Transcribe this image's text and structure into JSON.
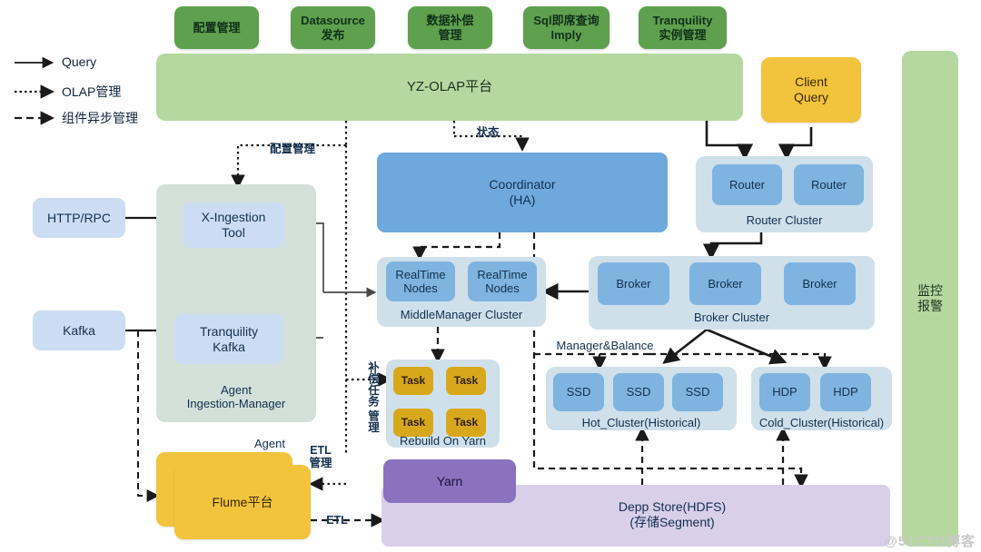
{
  "legend": {
    "items": [
      {
        "label": "Query",
        "style": "solid"
      },
      {
        "label": "OLAP管理",
        "style": "dotted"
      },
      {
        "label": "组件异步管理",
        "style": "dashed"
      }
    ]
  },
  "top_modules": [
    {
      "label": "配置管理"
    },
    {
      "label": "Datasource\n发布"
    },
    {
      "label": "数据补偿\n管理"
    },
    {
      "label": "Sql即席查询\nImply"
    },
    {
      "label": "Tranquility\n实例管理"
    }
  ],
  "platform": {
    "label": "YZ-OLAP平台"
  },
  "client": {
    "label": "Client\nQuery"
  },
  "monitor": {
    "label": "监控\n报警"
  },
  "sources": [
    {
      "label": "HTTP/RPC"
    },
    {
      "label": "Kafka"
    }
  ],
  "agent_group": {
    "caption": "Agent\nIngestion-Manager",
    "nodes": [
      {
        "label": "X-Ingestion\nTool"
      },
      {
        "label": "Tranquility\nKafka"
      }
    ]
  },
  "flume": {
    "label": "Flume平台",
    "badge": "Agent"
  },
  "coordinator": {
    "label": "Coordinator\n(HA)"
  },
  "middlemanager": {
    "caption": "MiddleManager Cluster",
    "nodes": [
      {
        "label": "RealTime\nNodes"
      },
      {
        "label": "RealTime\nNodes"
      }
    ]
  },
  "rebuild": {
    "caption": "Rebuild On Yarn",
    "tasks": [
      {
        "label": "Task"
      },
      {
        "label": "Task"
      },
      {
        "label": "Task"
      },
      {
        "label": "Task"
      }
    ]
  },
  "yarn": {
    "label": "Yarn"
  },
  "deep_store": {
    "label": "Depp Store(HDFS)\n(存储Segment)"
  },
  "router_cluster": {
    "caption": "Router Cluster",
    "nodes": [
      {
        "label": "Router"
      },
      {
        "label": "Router"
      }
    ]
  },
  "broker_cluster": {
    "caption": "Broker Cluster",
    "nodes": [
      {
        "label": "Broker"
      },
      {
        "label": "Broker"
      },
      {
        "label": "Broker"
      }
    ]
  },
  "hot_cluster": {
    "caption": "Hot_Cluster(Historical)",
    "nodes": [
      {
        "label": "SSD"
      },
      {
        "label": "SSD"
      },
      {
        "label": "SSD"
      }
    ]
  },
  "cold_cluster": {
    "caption": "Cold_Cluster(Historical)",
    "nodes": [
      {
        "label": "HDP"
      },
      {
        "label": "HDP"
      }
    ]
  },
  "edge_labels": {
    "config_mgmt": "配置管理",
    "status": "状态",
    "compensation": "补偿任务\n管理",
    "etl_mgmt": "ETL\n管理",
    "etl": "ETL",
    "manager_balance": "Manager&Balance"
  },
  "watermark": "@51CTO博客",
  "colors": {
    "green_button": "#5fa04e",
    "platform_green": "#b5d8a0",
    "gold": "#f2c43d",
    "task_gold": "#d8a81c",
    "blue_node": "#7fb4e0",
    "coordinator_blue": "#6fa8dc",
    "cluster_tray": "#cfe0ea",
    "pale_blue": "#ccdcf2",
    "agent_tray": "#d3e0da",
    "lilac": "#d9cfe8",
    "purple": "#8b72bf",
    "arrow": "#1a1a1a"
  }
}
